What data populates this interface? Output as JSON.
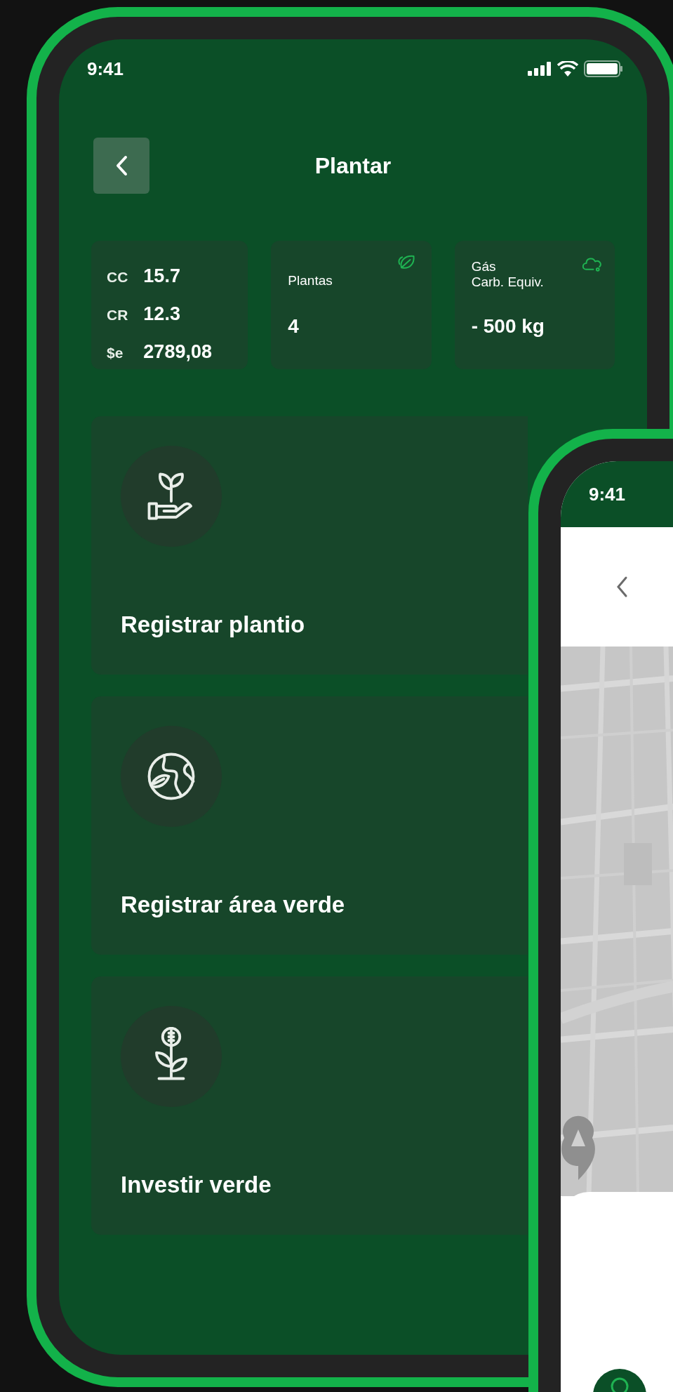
{
  "main_screen": {
    "status_bar": {
      "time": "9:41"
    },
    "header": {
      "title": "Plantar"
    },
    "stats": [
      {
        "kind": "rates",
        "rows": [
          {
            "label": "CC",
            "value": "15.7"
          },
          {
            "label": "CR",
            "value": "12.3"
          },
          {
            "label": "$e",
            "value": "2789,08"
          }
        ]
      },
      {
        "kind": "plants",
        "label_lines": [
          "Plantas"
        ],
        "value": "4"
      },
      {
        "kind": "gas",
        "label_lines": [
          "Gás",
          "Carb. Equiv."
        ],
        "value": "- 500 kg"
      }
    ],
    "actions": [
      {
        "kind": "planting",
        "label": "Registrar plantio"
      },
      {
        "kind": "area",
        "label": "Registrar área verde"
      },
      {
        "kind": "invest",
        "label": "Investir verde"
      }
    ]
  },
  "map_screen": {
    "status_bar": {
      "time": "9:41"
    }
  }
}
